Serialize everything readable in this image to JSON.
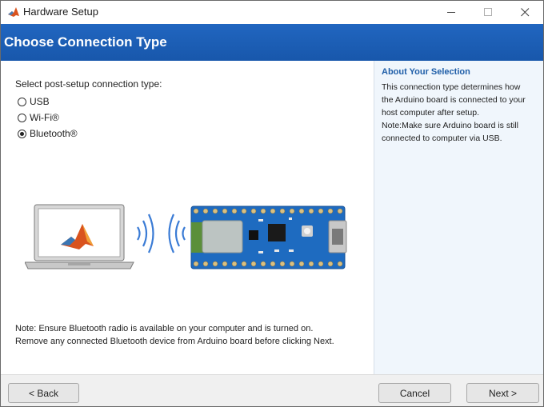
{
  "window": {
    "title": "Hardware Setup"
  },
  "header": {
    "title": "Choose Connection Type"
  },
  "main": {
    "prompt": "Select post-setup connection type:",
    "options": [
      {
        "label": "USB",
        "selected": false
      },
      {
        "label": "Wi-Fi®",
        "selected": false
      },
      {
        "label": "Bluetooth®",
        "selected": true
      }
    ],
    "note_line1": "Note: Ensure Bluetooth radio is available on your computer and is turned on.",
    "note_line2": "Remove any connected Bluetooth device from Arduino board before clicking Next."
  },
  "side": {
    "title": "About Your Selection",
    "text": "This connection type determines how\nthe Arduino board is connected to your\nhost computer after setup.\nNote:Make sure Arduino board is still\nconnected to computer via USB."
  },
  "footer": {
    "back_label": "< Back",
    "cancel_label": "Cancel",
    "next_label": "Next >"
  },
  "icons": {
    "app": "matlab-icon",
    "laptop": "laptop-icon",
    "signal": "bluetooth-signal-icon",
    "board": "arduino-board-icon"
  },
  "colors": {
    "header": "#1a5fb4",
    "side_bg": "#f0f6fc",
    "board": "#1e6bc0"
  }
}
